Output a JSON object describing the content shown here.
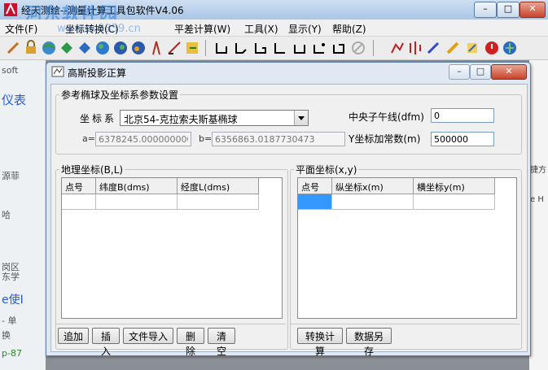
{
  "app": {
    "title": "经天测绘--测量计算工具包软件V4.06",
    "watermark": "河东软件园",
    "watermark_sub": "www.pc0359.cn"
  },
  "menu": [
    "文件(F)",
    "坐标转换(C)",
    "平差计算(W)",
    "工具(X)",
    "显示(Y)",
    "帮助(Z)"
  ],
  "background": {
    "left_fragments": [
      "soft",
      "仪表",
      "源菲",
      "哈",
      "岗区",
      "东学",
      "e使Ⅰ",
      "- 单",
      "换",
      "p-87"
    ],
    "right_fragments": [
      "捷方",
      "e H"
    ]
  },
  "dialog": {
    "title": "高斯投影正算",
    "ellipsoid_group": {
      "legend": "参考椭球及坐标系参数设置",
      "coord_label": "坐标系",
      "coord_value": "北京54-克拉索夫斯基椭球",
      "a_label": "a=",
      "a_value": "6378245.0000000000",
      "b_label": "b=",
      "b_value": "6356863.0187730473",
      "meridian_label": "中央子午线(dfm)",
      "meridian_value": "0",
      "yadd_label": "Y坐标加常数(m)",
      "yadd_value": "500000"
    },
    "geo_group": {
      "legend": "地理坐标(B,L)",
      "columns": [
        "点号",
        "纬度B(dms)",
        "经度L(dms)"
      ],
      "buttons": [
        "追加",
        "插入",
        "文件导入",
        "删除",
        "清空"
      ]
    },
    "plane_group": {
      "legend": "平面坐标(x,y)",
      "columns": [
        "点号",
        "纵坐标x(m)",
        "横坐标y(m)"
      ],
      "buttons": [
        "转换计算",
        "数据另存"
      ]
    }
  },
  "colors": {
    "selection": "#3399ff",
    "title_gradient_top": "#cfe0f2",
    "close_button": "#c8442b"
  }
}
